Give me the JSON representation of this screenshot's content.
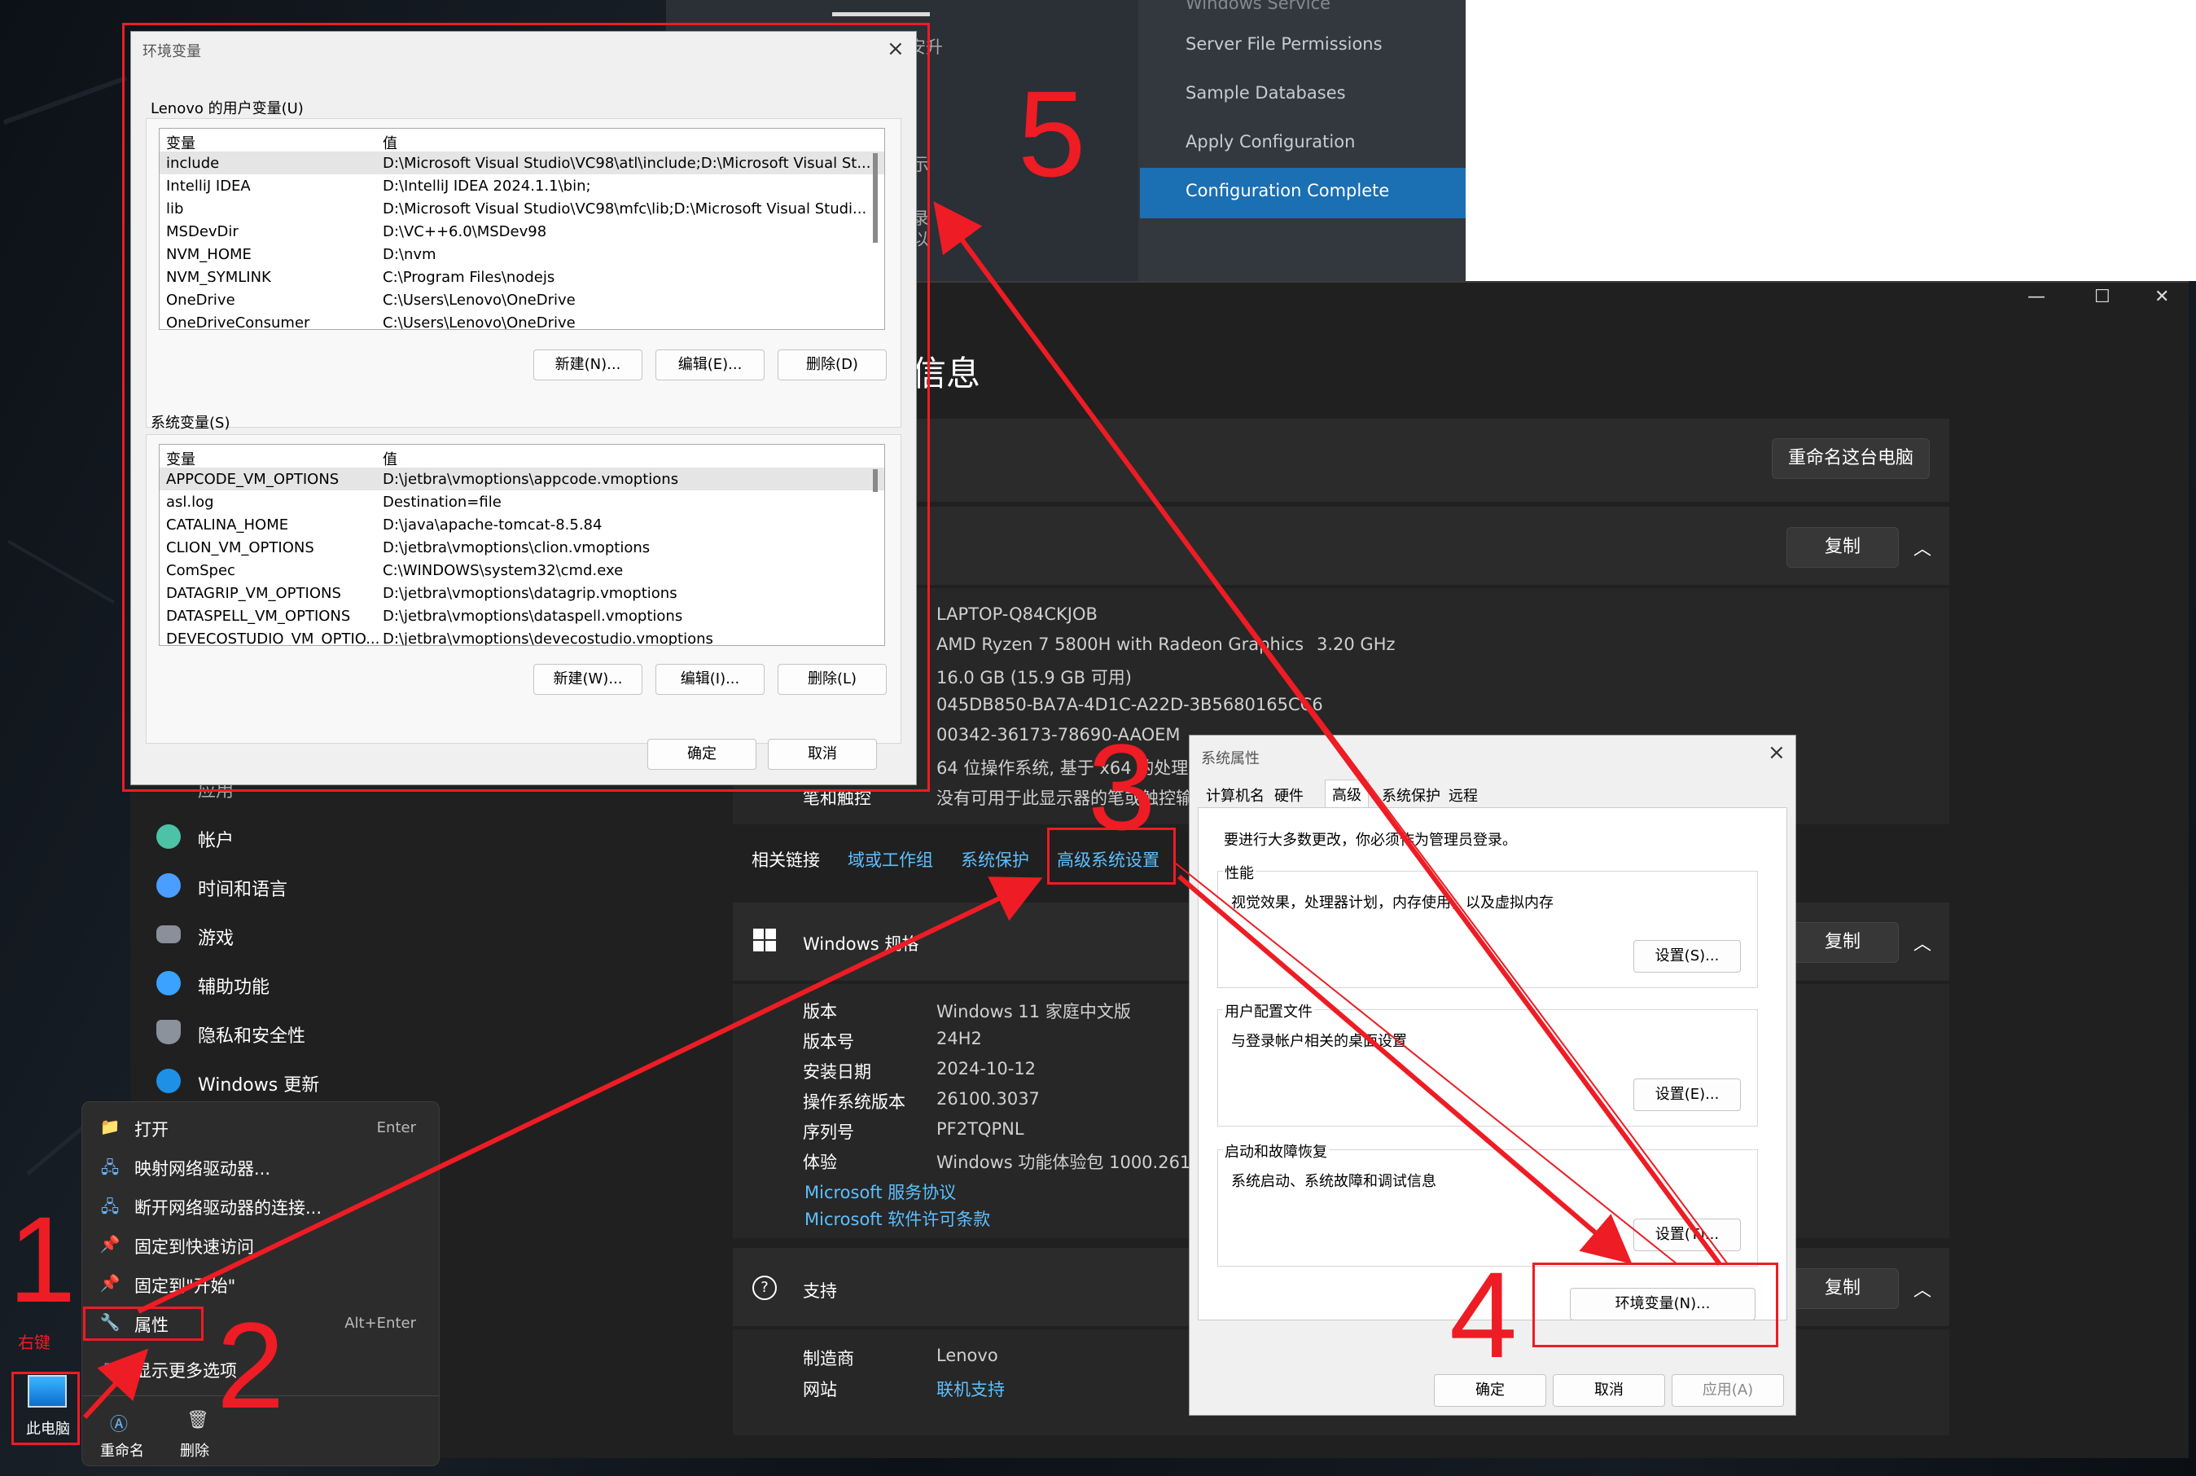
{
  "ssms": {
    "items": [
      "Server File Permissions",
      "Sample Databases",
      "Apply Configuration",
      "Configuration Complete"
    ],
    "selected_index": 3,
    "header_fragment": "Windows Service",
    "side_frag1": "安升",
    "side_frag2": "示",
    "side_frag3": "录",
    "side_frag4": "以"
  },
  "settings": {
    "title_frag": "信息",
    "rename_btn": "重命名这台电脑",
    "copy_btn": "复制",
    "device": {
      "values": [
        "LAPTOP-Q84CKJOB",
        "AMD Ryzen 7 5800H with Radeon Graphics",
        "16.0 GB (15.9 GB 可用)",
        "045DB850-BA7A-4D1C-A22D-3B5680165CC6",
        "00342-36173-78690-AAOEM",
        "64 位操作系统, 基于 x64 的处理器",
        "没有可用于此显示器的笔或触控输入"
      ],
      "cpu_speed": "3.20 GHz",
      "pen_label": "笔和触控"
    },
    "related": {
      "label": "相关链接",
      "links": [
        "域或工作组",
        "系统保护",
        "高级系统设置"
      ]
    },
    "winspec": {
      "title": "Windows 规格",
      "rows": [
        {
          "k": "版本",
          "v": "Windows 11 家庭中文版"
        },
        {
          "k": "版本号",
          "v": "24H2"
        },
        {
          "k": "安装日期",
          "v": "2024-10-12"
        },
        {
          "k": "操作系统版本",
          "v": "26100.3037"
        },
        {
          "k": "序列号",
          "v": "PF2TQPNL"
        },
        {
          "k": "体验",
          "v": "Windows 功能体验包 1000.26100."
        }
      ],
      "links": [
        "Microsoft 服务协议",
        "Microsoft 软件许可条款"
      ]
    },
    "support": {
      "title": "支持",
      "rows": [
        {
          "k": "制造商",
          "v": "Lenovo"
        },
        {
          "k": "网站",
          "v": "联机支持"
        }
      ]
    },
    "nav": [
      "应用",
      "帐户",
      "时间和语言",
      "游戏",
      "辅助功能",
      "隐私和安全性",
      "Windows 更新"
    ],
    "win_controls": [
      "—",
      "☐",
      "✕"
    ]
  },
  "context_menu": {
    "items": [
      {
        "label": "打开",
        "kbd": "Enter",
        "icon": "📁"
      },
      {
        "label": "映射网络驱动器...",
        "kbd": "",
        "icon": "🖧"
      },
      {
        "label": "断开网络驱动器的连接...",
        "kbd": "",
        "icon": "🖧"
      },
      {
        "label": "固定到快速访问",
        "kbd": "",
        "icon": "📌"
      },
      {
        "label": "固定到\"开始\"",
        "kbd": "",
        "icon": "📌"
      },
      {
        "label": "属性",
        "kbd": "Alt+Enter",
        "icon": "🔧"
      },
      {
        "label": "显示更多选项",
        "kbd": "",
        "icon": "⧉"
      }
    ],
    "bottom": [
      {
        "label": "重命名",
        "icon": "Ⓐ"
      },
      {
        "label": "删除",
        "icon": "🗑"
      }
    ]
  },
  "desktop": {
    "icon_label": "此电脑",
    "right_click_note": "右键"
  },
  "sysprops": {
    "title": "系统属性",
    "tabs": [
      "计算机名",
      "硬件",
      "高级",
      "系统保护",
      "远程"
    ],
    "active_tab": 2,
    "admin_note": "要进行大多数更改，你必须作为管理员登录。",
    "groups": [
      {
        "title": "性能",
        "desc": "视觉效果，处理器计划，内存使用，以及虚拟内存",
        "btn": "设置(S)..."
      },
      {
        "title": "用户配置文件",
        "desc": "与登录帐户相关的桌面设置",
        "btn": "设置(E)..."
      },
      {
        "title": "启动和故障恢复",
        "desc": "系统启动、系统故障和调试信息",
        "btn": "设置(T)..."
      }
    ],
    "env_btn": "环境变量(N)...",
    "ok": "确定",
    "cancel": "取消",
    "apply": "应用(A)"
  },
  "envvars": {
    "title": "环境变量",
    "user_label": "Lenovo 的用户变量(U)",
    "col_var": "变量",
    "col_val": "值",
    "user_vars": [
      {
        "k": "include",
        "v": "D:\\Microsoft Visual Studio\\VC98\\atl\\include;D:\\Microsoft Visual St..."
      },
      {
        "k": "IntelliJ IDEA",
        "v": "D:\\IntelliJ IDEA 2024.1.1\\bin;"
      },
      {
        "k": "lib",
        "v": "D:\\Microsoft Visual Studio\\VC98\\mfc\\lib;D:\\Microsoft Visual Studi..."
      },
      {
        "k": "MSDevDir",
        "v": "D:\\VC++6.0\\MSDev98"
      },
      {
        "k": "NVM_HOME",
        "v": "D:\\nvm"
      },
      {
        "k": "NVM_SYMLINK",
        "v": "C:\\Program Files\\nodejs"
      },
      {
        "k": "OneDrive",
        "v": "C:\\Users\\Lenovo\\OneDrive"
      },
      {
        "k": "OneDriveConsumer",
        "v": "C:\\Users\\Lenovo\\OneDrive"
      }
    ],
    "user_btns": [
      "新建(N)...",
      "编辑(E)...",
      "删除(D)"
    ],
    "sys_label": "系统变量(S)",
    "sys_vars": [
      {
        "k": "APPCODE_VM_OPTIONS",
        "v": "D:\\jetbra\\vmoptions\\appcode.vmoptions"
      },
      {
        "k": "asl.log",
        "v": "Destination=file"
      },
      {
        "k": "CATALINA_HOME",
        "v": "D:\\java\\apache-tomcat-8.5.84"
      },
      {
        "k": "CLION_VM_OPTIONS",
        "v": "D:\\jetbra\\vmoptions\\clion.vmoptions"
      },
      {
        "k": "ComSpec",
        "v": "C:\\WINDOWS\\system32\\cmd.exe"
      },
      {
        "k": "DATAGRIP_VM_OPTIONS",
        "v": "D:\\jetbra\\vmoptions\\datagrip.vmoptions"
      },
      {
        "k": "DATASPELL_VM_OPTIONS",
        "v": "D:\\jetbra\\vmoptions\\dataspell.vmoptions"
      },
      {
        "k": "DEVECOSTUDIO_VM_OPTIO...",
        "v": "D:\\jetbra\\vmoptions\\devecostudio.vmoptions"
      }
    ],
    "sys_btns": [
      "新建(W)...",
      "编辑(I)...",
      "删除(L)"
    ],
    "ok": "确定",
    "cancel": "取消"
  },
  "annotations": {
    "n1": "1",
    "n2": "2",
    "n3": "3",
    "n4": "4",
    "n5": "5",
    "color": "#ee1c24"
  }
}
